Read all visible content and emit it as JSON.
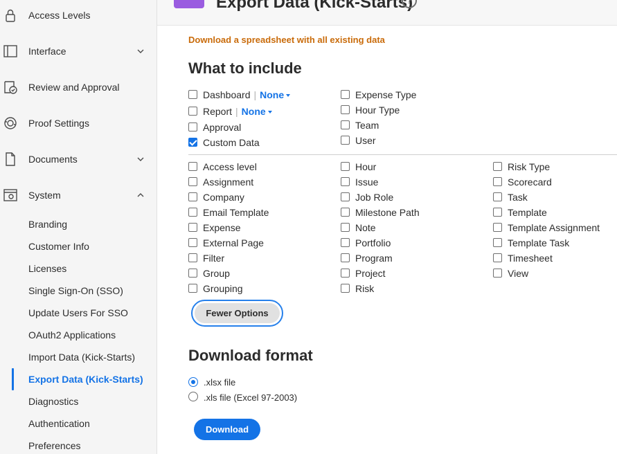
{
  "sidebar": {
    "items": [
      {
        "label": "Access Levels",
        "icon": "lock-icon",
        "expandable": false
      },
      {
        "label": "Interface",
        "icon": "layout-icon",
        "expandable": true,
        "expanded": false
      },
      {
        "label": "Review and Approval",
        "icon": "approval-icon",
        "expandable": false
      },
      {
        "label": "Proof Settings",
        "icon": "proof-icon",
        "expandable": false
      },
      {
        "label": "Documents",
        "icon": "document-icon",
        "expandable": true,
        "expanded": false
      },
      {
        "label": "System",
        "icon": "system-gear-icon",
        "expandable": true,
        "expanded": true
      }
    ],
    "system_subitems": [
      {
        "label": "Branding"
      },
      {
        "label": "Customer Info"
      },
      {
        "label": "Licenses"
      },
      {
        "label": "Single Sign-On (SSO)"
      },
      {
        "label": "Update Users For SSO"
      },
      {
        "label": "OAuth2 Applications"
      },
      {
        "label": "Import Data (Kick-Starts)"
      },
      {
        "label": "Export Data (Kick-Starts)",
        "active": true
      },
      {
        "label": "Diagnostics"
      },
      {
        "label": "Authentication"
      },
      {
        "label": "Preferences"
      }
    ]
  },
  "header": {
    "title": "Export Data (Kick-Starts)",
    "help": "?"
  },
  "main": {
    "subtitle": "Download a spreadsheet with all existing data",
    "include_heading": "What to include",
    "top_options_col1": [
      {
        "label": "Dashboard",
        "checked": false,
        "dropdown": "None"
      },
      {
        "label": "Report",
        "checked": false,
        "dropdown": "None"
      },
      {
        "label": "Approval",
        "checked": false
      },
      {
        "label": "Custom Data",
        "checked": true
      }
    ],
    "top_options_col2": [
      {
        "label": "Expense Type",
        "checked": false
      },
      {
        "label": "Hour Type",
        "checked": false
      },
      {
        "label": "Team",
        "checked": false
      },
      {
        "label": "User",
        "checked": false
      }
    ],
    "more_options_col1": [
      "Access level",
      "Assignment",
      "Company",
      "Email Template",
      "Expense",
      "External Page",
      "Filter",
      "Group",
      "Grouping"
    ],
    "more_options_col2": [
      "Hour",
      "Issue",
      "Job Role",
      "Milestone Path",
      "Note",
      "Portfolio",
      "Program",
      "Project",
      "Risk"
    ],
    "more_options_col3": [
      "Risk Type",
      "Scorecard",
      "Task",
      "Template",
      "Template Assignment",
      "Template Task",
      "Timesheet",
      "View"
    ],
    "fewer_options_label": "Fewer Options",
    "format_heading": "Download format",
    "formats": [
      {
        "label": ".xlsx file",
        "selected": true
      },
      {
        "label": ".xls file (Excel 97-2003)",
        "selected": false
      }
    ],
    "download_label": "Download"
  },
  "colors": {
    "accent": "#1473e6",
    "subtitle": "#c96b0a",
    "badge": "#9a5ce0"
  }
}
